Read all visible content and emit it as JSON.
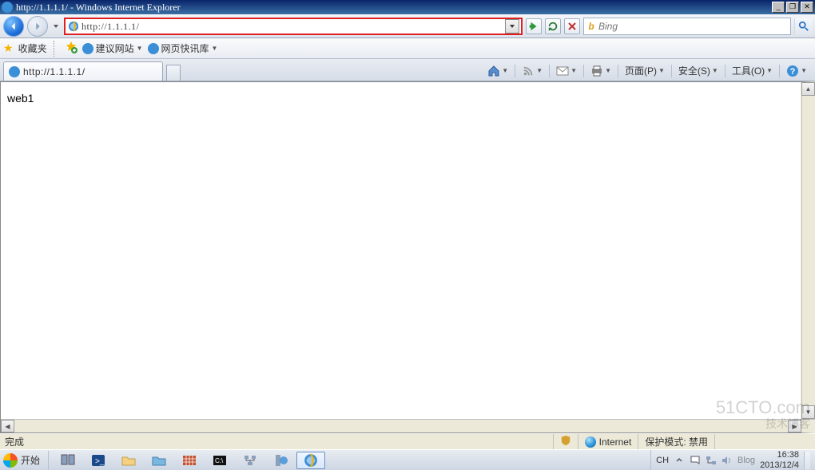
{
  "title": "http://1.1.1.1/ - Windows Internet Explorer",
  "address": {
    "url": "http://1.1.1.1/"
  },
  "search": {
    "placeholder": "Bing",
    "provider_icon": "b"
  },
  "favorites": {
    "label": "收藏夹",
    "links": [
      {
        "label": "建议网站"
      },
      {
        "label": "网页快讯库"
      }
    ]
  },
  "tab": {
    "title": "http://1.1.1.1/"
  },
  "toolbar": {
    "page": "页面(P)",
    "safety": "安全(S)",
    "tools": "工具(O)"
  },
  "page_content": "web1",
  "status": {
    "done": "完成",
    "zone": "Internet",
    "protected": "保护模式: 禁用"
  },
  "taskbar": {
    "start": "开始",
    "ime": "CH",
    "time": "16:38",
    "date": "2013/12/4"
  },
  "watermark": {
    "main": "51CTO.com",
    "sub": "技术博客",
    "blog": "Blog"
  }
}
